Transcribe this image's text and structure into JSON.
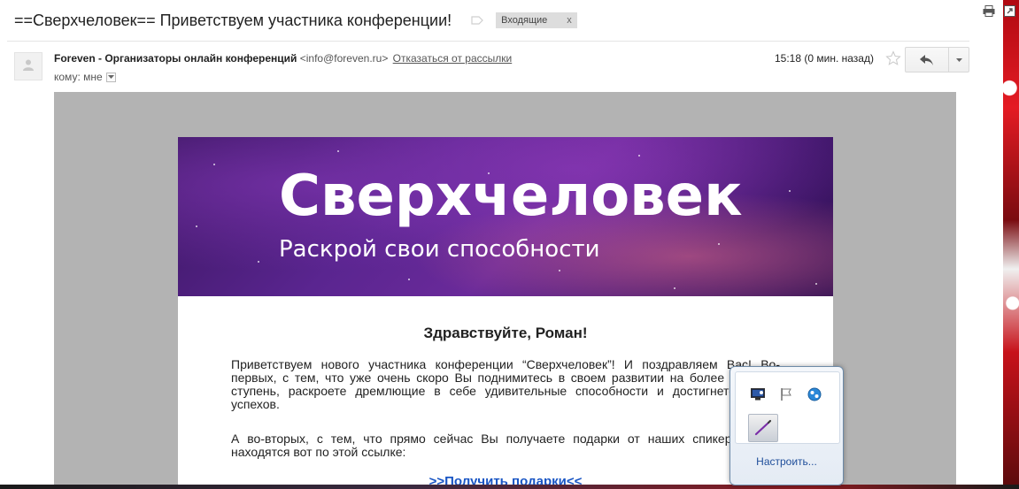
{
  "header": {
    "subject": "==Сверхчеловек== Приветствуем участника конференции!",
    "inbox_label": "Входящие",
    "inbox_close": "x"
  },
  "sender": {
    "name": "Foreven - Организаторы онлайн конференций",
    "email": "<info@foreven.ru>",
    "unsubscribe": "Отказаться от рассылки",
    "to_label": "кому: мне",
    "time": "15:18 (0 мин. назад)"
  },
  "email": {
    "banner_title": "Сверхчеловек",
    "banner_subtitle": "Раскрой свои способности",
    "greeting": "Здравствуйте, Роман!",
    "paragraph1": "Приветствуем нового участника конференции “Сверхчеловек”! И поздравляем Вас! Во-первых, с тем, что уже очень скоро Вы поднимитесь в своем развитии на более высокую ступень, раскроете дремлющие в себе удивительные способности и достигнете новых успехов.",
    "paragraph2": "А во-вторых, с тем, что прямо сейчас Вы получаете подарки от наших спикеров. Они находятся вот по этой ссылке:",
    "gift_link": ">>Получить подарки<<"
  },
  "tray": {
    "customize_link": "Настроить..."
  },
  "icons": [
    "print-icon",
    "new-window-icon",
    "label-icon",
    "avatar-icon",
    "star-icon",
    "reply-icon",
    "more-icon",
    "dropdown-icon",
    "monitor-icon",
    "flag-icon",
    "network-icon",
    "pen-icon"
  ]
}
